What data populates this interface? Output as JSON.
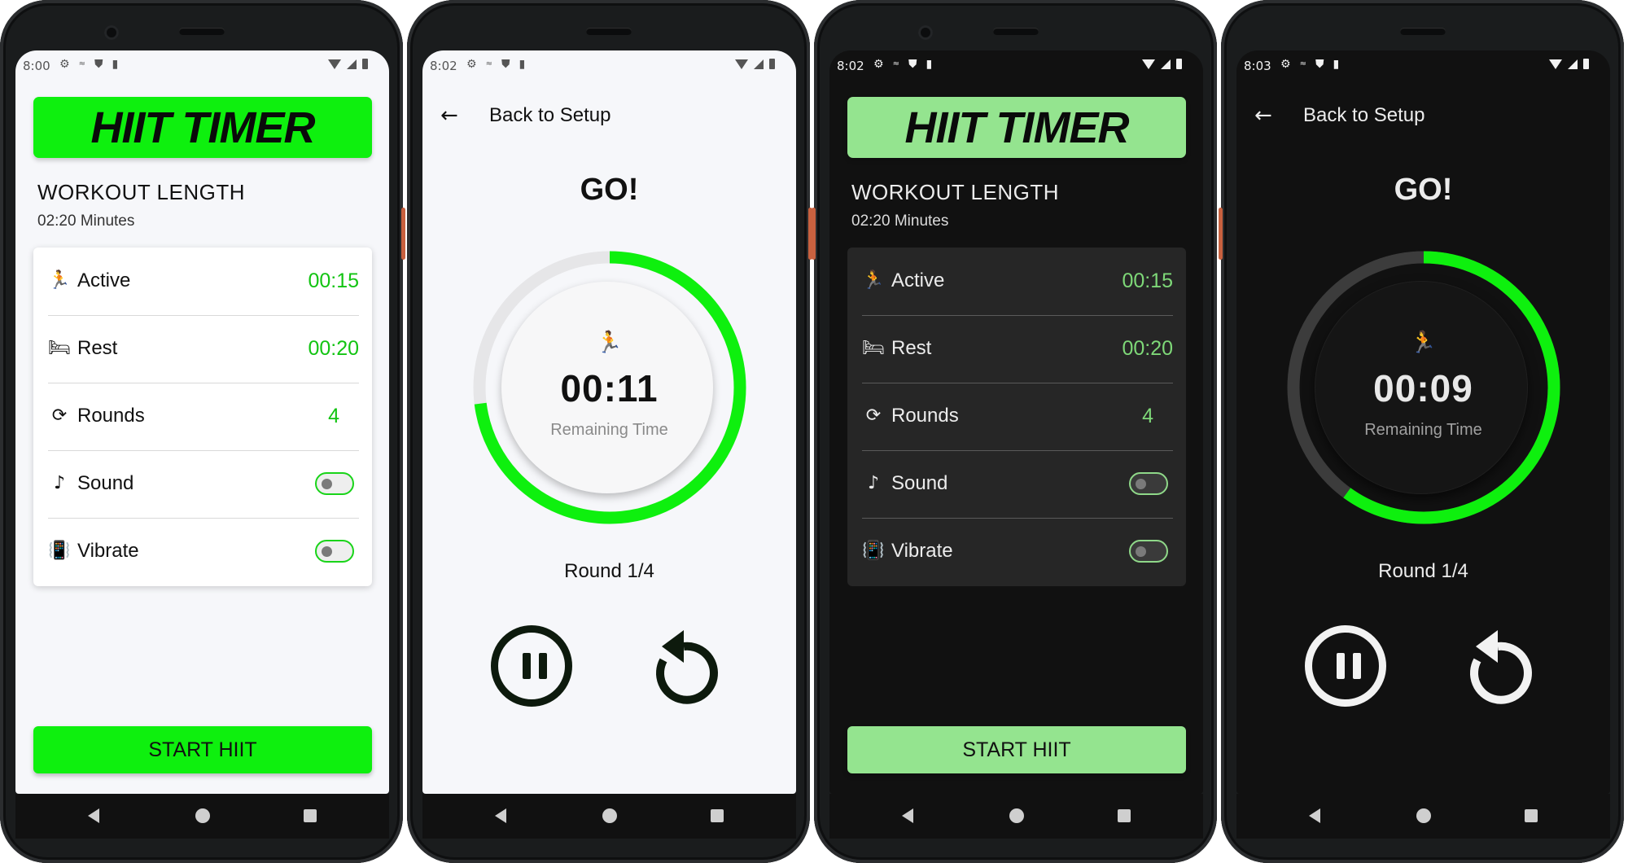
{
  "colors": {
    "accent_light": "#0ef00e",
    "accent_dark": "#94e48f",
    "ring_track_light": "#e6e6e8",
    "ring_track_dark": "#3c3c3c"
  },
  "screens": [
    {
      "status_time": "8:00",
      "title": "HIIT TIMER",
      "workout_length_label": "WORKOUT LENGTH",
      "workout_length_value": "02:20 Minutes",
      "settings": [
        {
          "icon": "running-icon",
          "label": "Active",
          "value": "00:15"
        },
        {
          "icon": "resting-icon",
          "label": "Rest",
          "value": "00:20"
        },
        {
          "icon": "repeat-icon",
          "label": "Rounds",
          "value": "4"
        },
        {
          "icon": "music-note-icon",
          "label": "Sound",
          "toggle": false
        },
        {
          "icon": "vibrate-icon",
          "label": "Vibrate",
          "toggle": false
        }
      ],
      "start_button": "START HIIT"
    },
    {
      "status_time": "8:02",
      "back_label": "Back to Setup",
      "phase_label": "GO!",
      "remaining": "00:11",
      "remaining_label": "Remaining Time",
      "round_label": "Round 1/4",
      "progress": 0.73
    },
    {
      "status_time": "8:02",
      "title": "HIIT TIMER",
      "workout_length_label": "WORKOUT LENGTH",
      "workout_length_value": "02:20 Minutes",
      "settings": [
        {
          "icon": "running-icon",
          "label": "Active",
          "value": "00:15"
        },
        {
          "icon": "resting-icon",
          "label": "Rest",
          "value": "00:20"
        },
        {
          "icon": "repeat-icon",
          "label": "Rounds",
          "value": "4"
        },
        {
          "icon": "music-note-icon",
          "label": "Sound",
          "toggle": false
        },
        {
          "icon": "vibrate-icon",
          "label": "Vibrate",
          "toggle": false
        }
      ],
      "start_button": "START HIIT"
    },
    {
      "status_time": "8:03",
      "back_label": "Back to Setup",
      "phase_label": "GO!",
      "remaining": "00:09",
      "remaining_label": "Remaining Time",
      "round_label": "Round 1/4",
      "progress": 0.6
    }
  ]
}
